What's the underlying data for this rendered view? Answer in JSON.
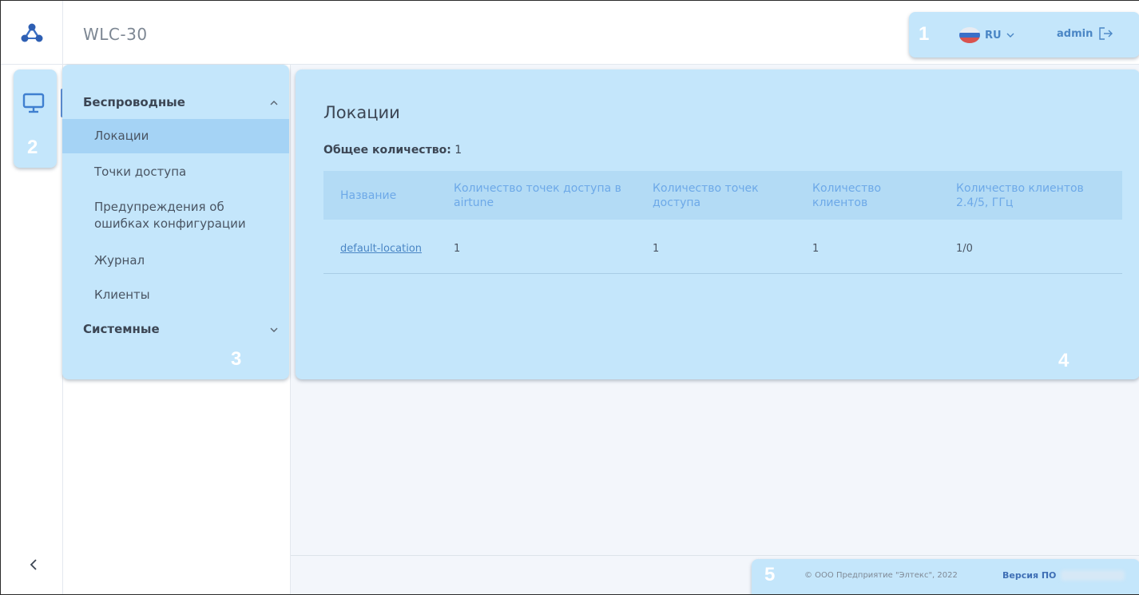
{
  "header": {
    "app_title": "WLC-30",
    "lang_label": "RU",
    "user_label": "admin"
  },
  "annotations": [
    "1",
    "2",
    "3",
    "4",
    "5"
  ],
  "sidebar": {
    "sections": [
      {
        "label": "Беспроводные",
        "expanded": true,
        "items": [
          {
            "label": "Локации",
            "active": true
          },
          {
            "label": "Точки доступа",
            "active": false
          },
          {
            "label": "Предупреждения об ошибках конфигурации",
            "active": false
          },
          {
            "label": "Журнал",
            "active": false
          },
          {
            "label": "Клиенты",
            "active": false
          }
        ]
      },
      {
        "label": "Системные",
        "expanded": false,
        "items": []
      }
    ]
  },
  "main": {
    "title": "Локации",
    "total_label": "Общее количество:",
    "total_value": "1",
    "table": {
      "columns": [
        "Название",
        "Количество точек доступа в airtune",
        "Количество точек доступа",
        "Количество клиентов",
        "Количество клиентов 2.4/5, ГГц"
      ],
      "rows": [
        [
          "default-location",
          "1",
          "1",
          "1",
          "1/0"
        ]
      ]
    }
  },
  "footer": {
    "copyright": "© ООО Предприятие \"Элтекс\", 2022",
    "version_label": "Версия ПО"
  },
  "colors": {
    "highlight": "#c4e6fb",
    "accent": "#4a86c5",
    "active_item": "#a5d3f5",
    "table_header": "#b3dbf5",
    "page_bg": "#f3f6fb"
  }
}
